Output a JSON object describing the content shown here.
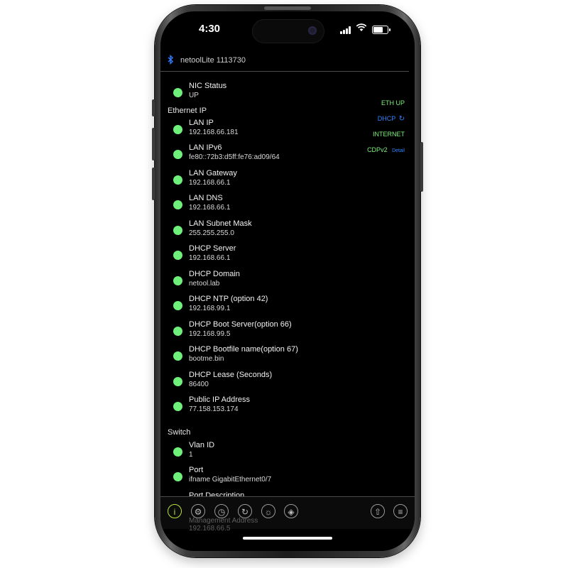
{
  "status_bar": {
    "time": "4:30",
    "signal_icon": "cell-signal-icon",
    "wifi_icon": "wifi-icon",
    "battery_icon": "battery-icon"
  },
  "header": {
    "bluetooth_icon": "bluetooth-icon",
    "device_name": "netoolLite 1113730"
  },
  "nic": {
    "label": "NIC Status",
    "value": "UP"
  },
  "sections": {
    "ethernet": "Ethernet IP",
    "switch": "Switch"
  },
  "ethernet_rows": [
    {
      "label": "LAN IP",
      "value": "192.168.66.181"
    },
    {
      "label": "LAN IPv6",
      "value": "fe80::72b3:d5ff:fe76:ad09/64"
    },
    {
      "label": "LAN Gateway",
      "value": "192.168.66.1"
    },
    {
      "label": "LAN DNS",
      "value": "192.168.66.1"
    },
    {
      "label": "LAN Subnet Mask",
      "value": "255.255.255.0"
    },
    {
      "label": "DHCP Server",
      "value": "192.168.66.1"
    },
    {
      "label": "DHCP Domain",
      "value": "netool.lab"
    },
    {
      "label": "DHCP NTP (option 42)",
      "value": "192.168.99.1"
    },
    {
      "label": "DHCP Boot Server(option 66)",
      "value": "192.168.99.5"
    },
    {
      "label": "DHCP Bootfile name(option 67)",
      "value": "bootme.bin"
    },
    {
      "label": "DHCP Lease (Seconds)",
      "value": "86400"
    },
    {
      "label": "Public IP Address",
      "value": "77.158.153.174"
    }
  ],
  "switch_rows": [
    {
      "label": "Vlan ID",
      "value": "1"
    },
    {
      "label": "Port",
      "value": "ifname GigabitEthernet0/7"
    },
    {
      "label": "Port Description",
      "value": ""
    }
  ],
  "tags": {
    "eth_up": "ETH UP",
    "dhcp": "DHCP",
    "dhcp_icon": "refresh-icon",
    "internet": "INTERNET",
    "cdp": "CDPv2",
    "detail": "Detail"
  },
  "colors": {
    "status_green": "#6ff07a",
    "accent_blue": "#2f86ff",
    "active_tab": "#b8e03a"
  },
  "toolbar": {
    "items": [
      "info-icon",
      "settings-gear-icon",
      "clock-icon",
      "refresh-icon",
      "sun-icon",
      "tag-icon",
      "share-icon",
      "list-icon"
    ],
    "info_glyph": "i",
    "ghost_text": "Management Address",
    "ghost_value": "192.168.66.5"
  }
}
